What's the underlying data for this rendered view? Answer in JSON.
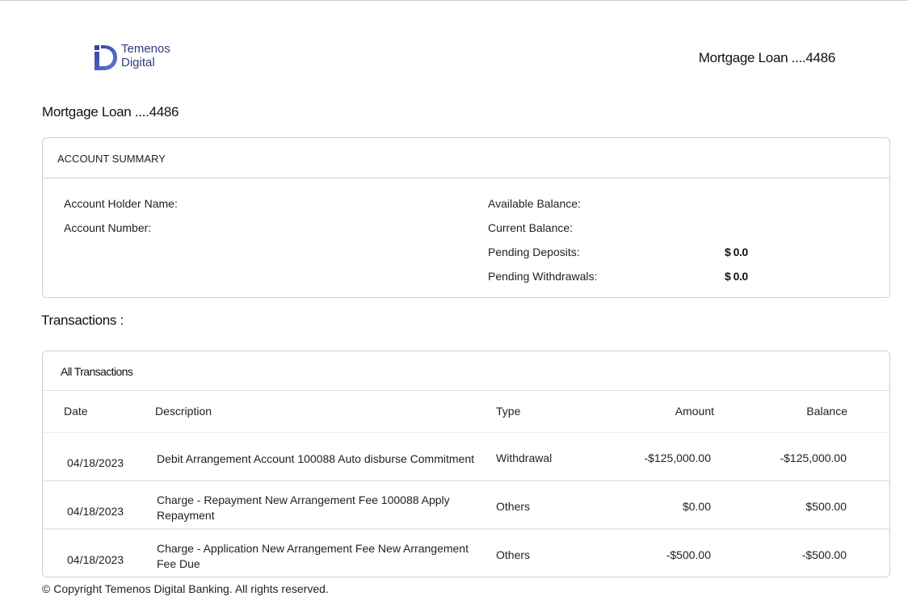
{
  "header": {
    "logo_line1": "Temenos",
    "logo_line2": "Digital",
    "title": "Mortgage Loan ....4486"
  },
  "page_title": "Mortgage Loan ....4486",
  "summary": {
    "heading": "ACCOUNT SUMMARY",
    "left_fields": [
      {
        "label": "Account Holder Name:",
        "value": ""
      },
      {
        "label": "Account Number:",
        "value": ""
      }
    ],
    "right_fields": [
      {
        "label": "Available Balance:",
        "value": ""
      },
      {
        "label": "Current Balance:",
        "value": ""
      },
      {
        "label": "Pending Deposits:",
        "value": "$ 0.0"
      },
      {
        "label": "Pending Withdrawals:",
        "value": "$ 0.0"
      }
    ]
  },
  "transactions": {
    "section_title": "Transactions :",
    "tab_label": "All Transactions",
    "columns": [
      "Date",
      "Description",
      "Type",
      "Amount",
      "Balance"
    ],
    "rows": [
      {
        "date": "04/18/2023",
        "description": "Debit Arrangement Account 100088 Auto disburse Commitment",
        "type": "Withdrawal",
        "amount": "-$125,000.00",
        "balance": "-$125,000.00"
      },
      {
        "date": "04/18/2023",
        "description": "Charge - Repayment New Arrangement Fee 100088 Apply Repayment",
        "type": "Others",
        "amount": "$0.00",
        "balance": "$500.00"
      },
      {
        "date": "04/18/2023",
        "description": "Charge - Application New Arrangement Fee New Arrangement Fee Due",
        "type": "Others",
        "amount": "-$500.00",
        "balance": "-$500.00"
      }
    ]
  },
  "footer": {
    "copyright": "© Copyright Temenos Digital Banking. All rights reserved."
  },
  "colors": {
    "brand": "#2e3a78",
    "border": "#cfcfcf",
    "row_divider": "#e6ecef"
  }
}
